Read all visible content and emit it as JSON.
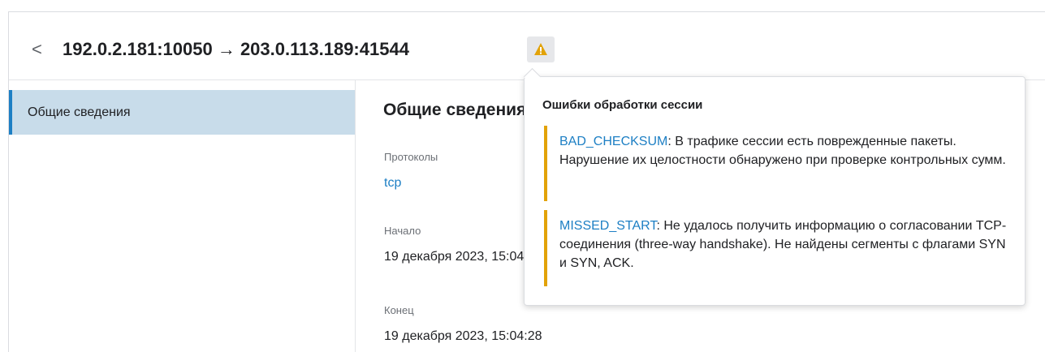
{
  "header": {
    "back_glyph": "<",
    "title": "192.0.2.181:10050 → 203.0.113.189:41544",
    "warning_icon": "warning-triangle-icon",
    "warning_color": "#e2a208"
  },
  "sidebar": {
    "items": [
      {
        "label": "Общие сведения",
        "active": true
      }
    ]
  },
  "main": {
    "section_title": "Общие сведения",
    "fields": [
      {
        "label": "Протоколы",
        "value": "tcp"
      },
      {
        "label": "Начало",
        "value": "19 декабря 2023, 15:04:28"
      },
      {
        "label": "Конец",
        "value": "19 декабря 2023, 15:04:28"
      }
    ]
  },
  "popover": {
    "title": "Ошибки обработки сессии",
    "errors": [
      {
        "code": "BAD_CHECKSUM",
        "message": ": В трафике сессии есть поврежденные пакеты. Нарушение их целостности обнаружено при проверке контрольных сумм."
      },
      {
        "code": "MISSED_START",
        "message": ": Не удалось получить информацию о согласовании TCP-соединения (three-way handshake). Не найдены сегменты с флагами SYN и SYN, ACK."
      }
    ]
  },
  "colors": {
    "accent": "#1d7fc4",
    "nav_active_bg": "#c8dcea",
    "error_bar": "#e2a208"
  }
}
